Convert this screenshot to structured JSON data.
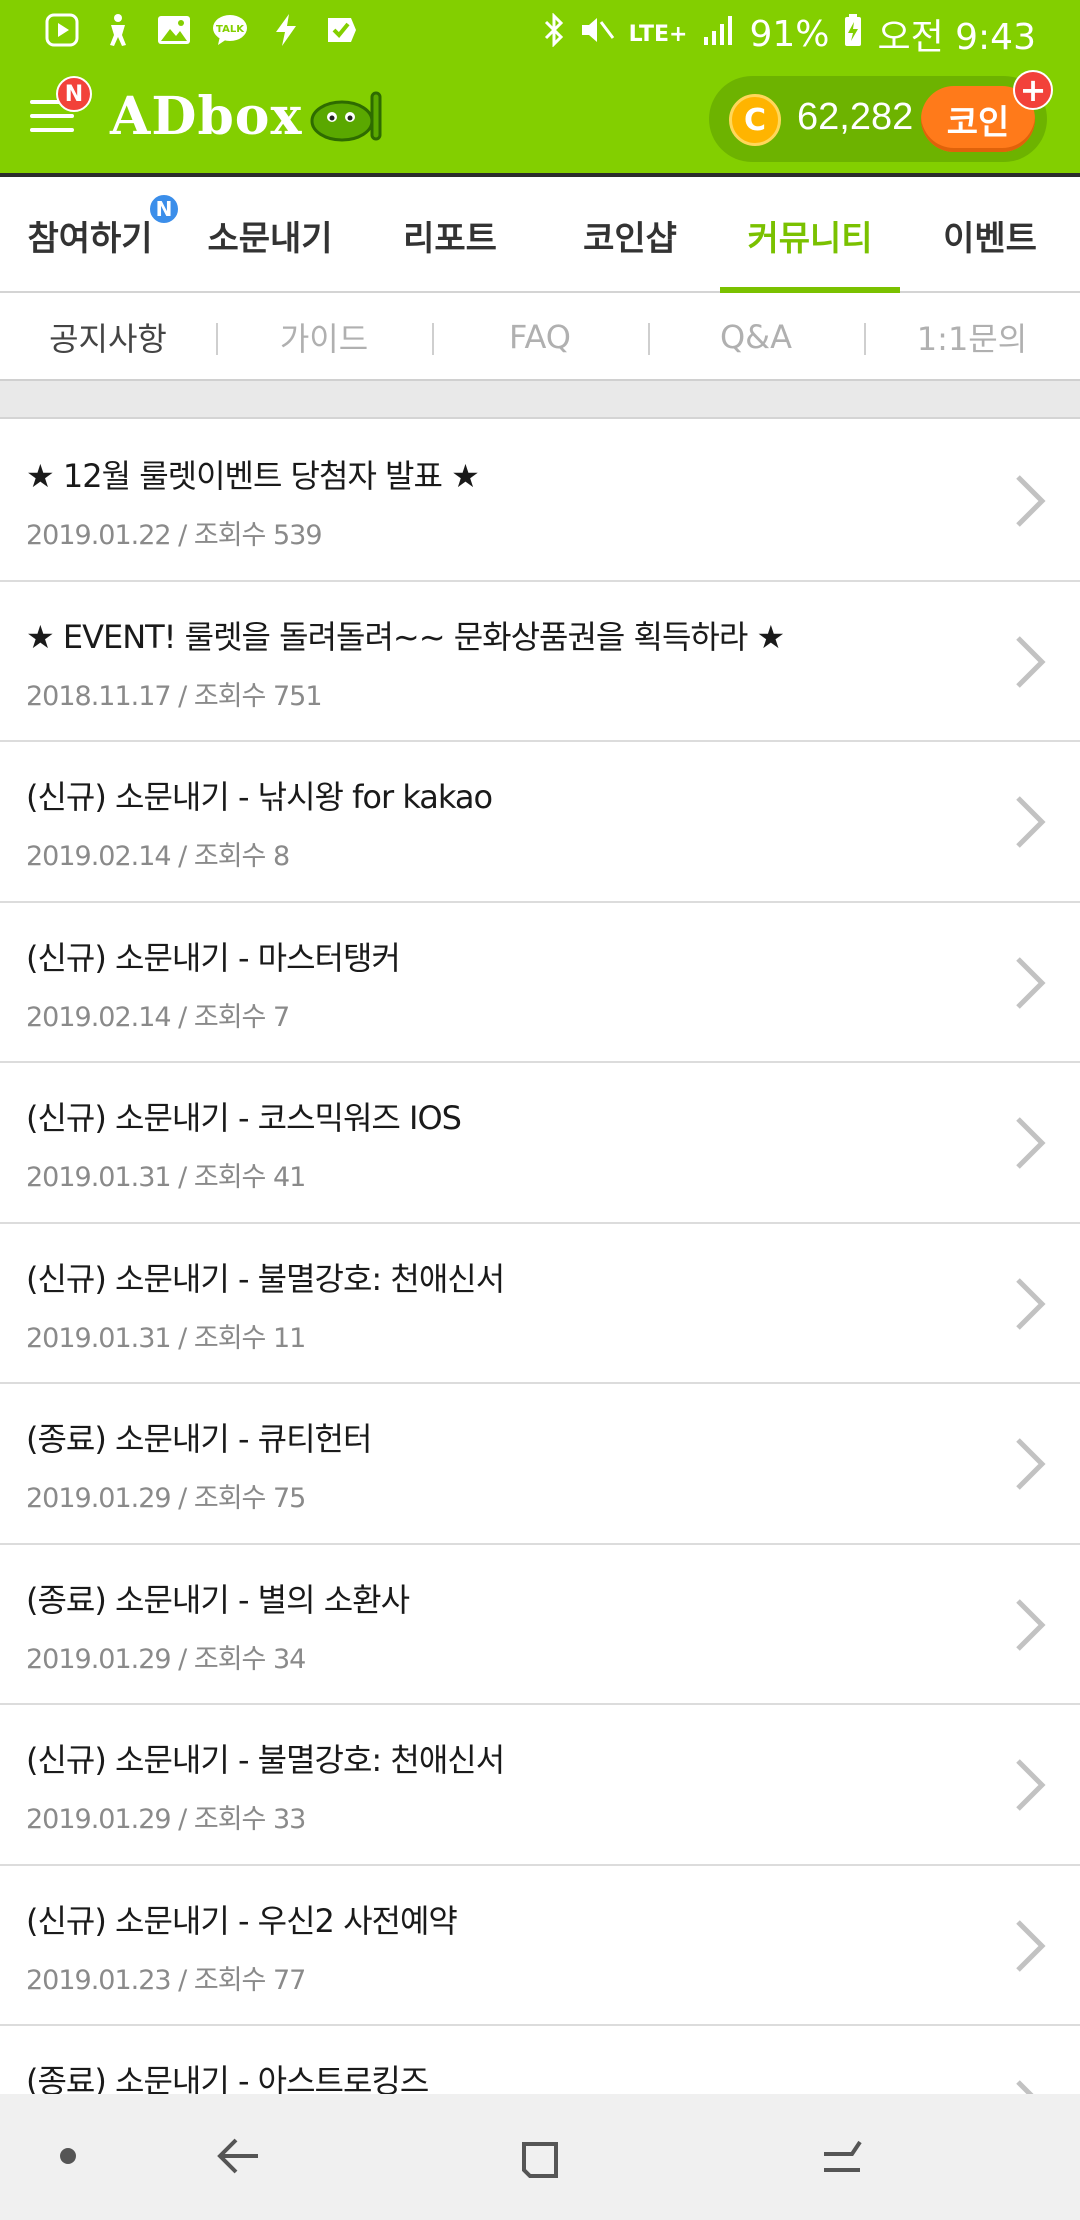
{
  "status_bar": {
    "battery": "91%",
    "time": "오전 9:43",
    "network": "LTE+",
    "notification_icons": [
      "play-store-icon",
      "accessibility-icon",
      "gallery-icon",
      "kakaotalk-icon",
      "flash-icon",
      "check-icon"
    ]
  },
  "header": {
    "brand": "ADbox",
    "menu_badge": "N",
    "coin_symbol": "C",
    "coin_amount": "62,282",
    "coin_button": "코인",
    "coin_plus": "+"
  },
  "tabs": [
    {
      "label": "참여하기",
      "badge": "N",
      "active": false
    },
    {
      "label": "소문내기",
      "active": false
    },
    {
      "label": "리포트",
      "active": false
    },
    {
      "label": "코인샵",
      "active": false
    },
    {
      "label": "커뮤니티",
      "active": true
    },
    {
      "label": "이벤트",
      "active": false
    }
  ],
  "subtabs": [
    {
      "label": "공지사항",
      "active": true
    },
    {
      "label": "가이드",
      "active": false
    },
    {
      "label": "FAQ",
      "active": false
    },
    {
      "label": "Q&A",
      "active": false
    },
    {
      "label": "1:1문의",
      "active": false
    }
  ],
  "notices": [
    {
      "title": "★ 12월 룰렛이벤트 당첨자 발표 ★",
      "date": "2019.01.22",
      "views_label": "조회수",
      "views": "539"
    },
    {
      "title": "★ EVENT! 룰렛을 돌려돌려~~ 문화상품권을 획득하라 ★",
      "date": "2018.11.17",
      "views_label": "조회수",
      "views": "751"
    },
    {
      "title": "(신규) 소문내기 - 낚시왕 for kakao",
      "date": "2019.02.14",
      "views_label": "조회수",
      "views": "8"
    },
    {
      "title": "(신규) 소문내기 - 마스터탱커",
      "date": "2019.02.14",
      "views_label": "조회수",
      "views": "7"
    },
    {
      "title": "(신규) 소문내기 - 코스믹워즈 IOS",
      "date": "2019.01.31",
      "views_label": "조회수",
      "views": "41"
    },
    {
      "title": "(신규) 소문내기 - 불멸강호: 천애신서",
      "date": "2019.01.31",
      "views_label": "조회수",
      "views": "11"
    },
    {
      "title": "(종료) 소문내기 - 큐티헌터",
      "date": "2019.01.29",
      "views_label": "조회수",
      "views": "75"
    },
    {
      "title": "(종료) 소문내기 - 별의 소환사",
      "date": "2019.01.29",
      "views_label": "조회수",
      "views": "34"
    },
    {
      "title": "(신규) 소문내기 - 불멸강호: 천애신서",
      "date": "2019.01.29",
      "views_label": "조회수",
      "views": "33"
    },
    {
      "title": "(신규) 소문내기 - 우신2 사전예약",
      "date": "2019.01.23",
      "views_label": "조회수",
      "views": "77"
    },
    {
      "title": "(종료) 소문내기 - 아스트로킹즈",
      "date": "",
      "views_label": "",
      "views": ""
    }
  ],
  "colors": {
    "brand_green": "#83cf00",
    "active_tab": "#7ac100",
    "coin_orange": "#ff7a1a",
    "badge_red": "#f2423a",
    "badge_blue": "#3b8eea"
  },
  "nav_bar": {
    "icons": [
      "dot-icon",
      "back-icon",
      "recents-icon",
      "menu-swipe-icon"
    ]
  }
}
